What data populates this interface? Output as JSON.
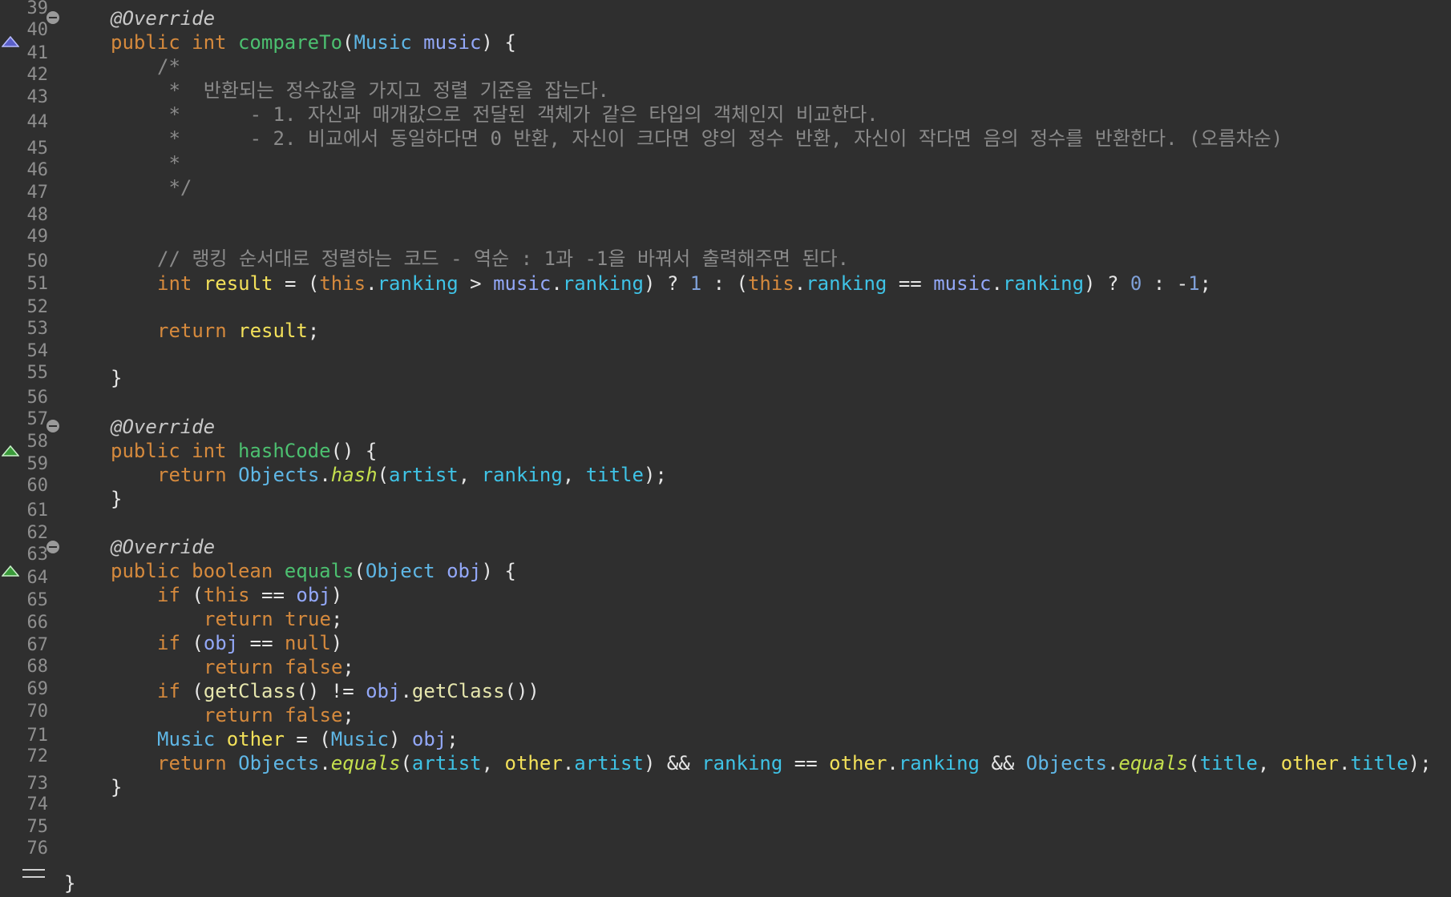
{
  "editor": {
    "line_numbers": [
      "39",
      "40",
      "41",
      "42",
      "43",
      "44",
      "45",
      "46",
      "47",
      "48",
      "49",
      "50",
      "51",
      "52",
      "53",
      "54",
      "55",
      "56",
      "57",
      "58",
      "59",
      "60",
      "61",
      "62",
      "63",
      "64",
      "65",
      "66",
      "67",
      "68",
      "69",
      "70",
      "71",
      "72",
      "73",
      "74",
      "75",
      "76"
    ],
    "fold_markers": [
      "collapse-icon",
      "collapse-icon",
      "collapse-icon"
    ],
    "override_markers": [
      "override-arrow-icon",
      "override-arrow-icon",
      "override-arrow-icon"
    ],
    "colors": {
      "background": "#2f2f2f",
      "keyword": "#d68a3d",
      "method_declaration": "#4cc070",
      "type": "#5fb7e6",
      "parameter": "#93a8f8",
      "local_variable": "#f3e15a",
      "field": "#3fc3e6",
      "number": "#7fa0d8",
      "comment": "#8a8a8a"
    },
    "code_lines": [
      [
        {
          "t": "@Override",
          "c": "ann"
        }
      ],
      [
        {
          "t": "public",
          "c": "kw"
        },
        {
          "t": " ",
          "c": "plain"
        },
        {
          "t": "int",
          "c": "kw"
        },
        {
          "t": " ",
          "c": "plain"
        },
        {
          "t": "compareTo",
          "c": "mdecl"
        },
        {
          "t": "(",
          "c": "plain"
        },
        {
          "t": "Music",
          "c": "type"
        },
        {
          "t": " ",
          "c": "plain"
        },
        {
          "t": "music",
          "c": "param"
        },
        {
          "t": ") {",
          "c": "plain"
        }
      ],
      [
        {
          "t": "/*",
          "c": "comment"
        }
      ],
      [
        {
          "t": " *  반환되는 정수값을 가지고 정렬 기준을 잡는다.",
          "c": "comment"
        }
      ],
      [
        {
          "t": " *      - 1. 자신과 매개값으로 전달된 객체가 같은 타입의 객체인지 비교한다.",
          "c": "comment"
        }
      ],
      [
        {
          "t": " *      - 2. 비교에서 동일하다면 0 반환, 자신이 크다면 양의 정수 반환, 자신이 작다면 음의 정수를 반환한다. (오름차순)",
          "c": "comment"
        }
      ],
      [
        {
          "t": " *",
          "c": "comment"
        }
      ],
      [
        {
          "t": " */",
          "c": "comment"
        }
      ],
      [
        {
          "t": "// 랭킹 순서대로 정렬하는 코드 - 역순 : 1과 -1을 바꿔서 출력해주면 된다.",
          "c": "comment"
        }
      ],
      [
        {
          "t": "int",
          "c": "kw"
        },
        {
          "t": " ",
          "c": "plain"
        },
        {
          "t": "result",
          "c": "local"
        },
        {
          "t": " = (",
          "c": "plain"
        },
        {
          "t": "this",
          "c": "kw"
        },
        {
          "t": ".",
          "c": "plain"
        },
        {
          "t": "ranking",
          "c": "field"
        },
        {
          "t": " > ",
          "c": "plain"
        },
        {
          "t": "music",
          "c": "param"
        },
        {
          "t": ".",
          "c": "plain"
        },
        {
          "t": "ranking",
          "c": "field"
        },
        {
          "t": ") ? ",
          "c": "plain"
        },
        {
          "t": "1",
          "c": "num"
        },
        {
          "t": " : (",
          "c": "plain"
        },
        {
          "t": "this",
          "c": "kw"
        },
        {
          "t": ".",
          "c": "plain"
        },
        {
          "t": "ranking",
          "c": "field"
        },
        {
          "t": " == ",
          "c": "plain"
        },
        {
          "t": "music",
          "c": "param"
        },
        {
          "t": ".",
          "c": "plain"
        },
        {
          "t": "ranking",
          "c": "field"
        },
        {
          "t": ") ? ",
          "c": "plain"
        },
        {
          "t": "0",
          "c": "num"
        },
        {
          "t": " : -",
          "c": "plain"
        },
        {
          "t": "1",
          "c": "num"
        },
        {
          "t": ";",
          "c": "plain"
        }
      ],
      [
        {
          "t": "return",
          "c": "kw"
        },
        {
          "t": " ",
          "c": "plain"
        },
        {
          "t": "result",
          "c": "local"
        },
        {
          "t": ";",
          "c": "plain"
        }
      ],
      [
        {
          "t": "}",
          "c": "plain"
        }
      ],
      [
        {
          "t": "@Override",
          "c": "ann"
        }
      ],
      [
        {
          "t": "public",
          "c": "kw"
        },
        {
          "t": " ",
          "c": "plain"
        },
        {
          "t": "int",
          "c": "kw"
        },
        {
          "t": " ",
          "c": "plain"
        },
        {
          "t": "hashCode",
          "c": "mdecl"
        },
        {
          "t": "() {",
          "c": "plain"
        }
      ],
      [
        {
          "t": "return",
          "c": "kw"
        },
        {
          "t": " ",
          "c": "plain"
        },
        {
          "t": "Objects",
          "c": "type"
        },
        {
          "t": ".",
          "c": "plain"
        },
        {
          "t": "hash",
          "c": "static"
        },
        {
          "t": "(",
          "c": "plain"
        },
        {
          "t": "artist",
          "c": "field"
        },
        {
          "t": ", ",
          "c": "plain"
        },
        {
          "t": "ranking",
          "c": "field"
        },
        {
          "t": ", ",
          "c": "plain"
        },
        {
          "t": "title",
          "c": "field"
        },
        {
          "t": ");",
          "c": "plain"
        }
      ],
      [
        {
          "t": "}",
          "c": "plain"
        }
      ],
      [
        {
          "t": "@Override",
          "c": "ann"
        }
      ],
      [
        {
          "t": "public",
          "c": "kw"
        },
        {
          "t": " ",
          "c": "plain"
        },
        {
          "t": "boolean",
          "c": "kw"
        },
        {
          "t": " ",
          "c": "plain"
        },
        {
          "t": "equals",
          "c": "mdecl"
        },
        {
          "t": "(",
          "c": "plain"
        },
        {
          "t": "Object",
          "c": "type"
        },
        {
          "t": " ",
          "c": "plain"
        },
        {
          "t": "obj",
          "c": "param"
        },
        {
          "t": ") {",
          "c": "plain"
        }
      ],
      [
        {
          "t": "if",
          "c": "kw"
        },
        {
          "t": " (",
          "c": "plain"
        },
        {
          "t": "this",
          "c": "kw"
        },
        {
          "t": " == ",
          "c": "plain"
        },
        {
          "t": "obj",
          "c": "param"
        },
        {
          "t": ")",
          "c": "plain"
        }
      ],
      [
        {
          "t": "return",
          "c": "kw"
        },
        {
          "t": " ",
          "c": "plain"
        },
        {
          "t": "true",
          "c": "kw"
        },
        {
          "t": ";",
          "c": "plain"
        }
      ],
      [
        {
          "t": "if",
          "c": "kw"
        },
        {
          "t": " (",
          "c": "plain"
        },
        {
          "t": "obj",
          "c": "param"
        },
        {
          "t": " == ",
          "c": "plain"
        },
        {
          "t": "null",
          "c": "kw"
        },
        {
          "t": ")",
          "c": "plain"
        }
      ],
      [
        {
          "t": "return",
          "c": "kw"
        },
        {
          "t": " ",
          "c": "plain"
        },
        {
          "t": "false",
          "c": "kw"
        },
        {
          "t": ";",
          "c": "plain"
        }
      ],
      [
        {
          "t": "if",
          "c": "kw"
        },
        {
          "t": " (",
          "c": "plain"
        },
        {
          "t": "getClass",
          "c": "call"
        },
        {
          "t": "() != ",
          "c": "plain"
        },
        {
          "t": "obj",
          "c": "param"
        },
        {
          "t": ".",
          "c": "plain"
        },
        {
          "t": "getClass",
          "c": "call"
        },
        {
          "t": "())",
          "c": "plain"
        }
      ],
      [
        {
          "t": "return",
          "c": "kw"
        },
        {
          "t": " ",
          "c": "plain"
        },
        {
          "t": "false",
          "c": "kw"
        },
        {
          "t": ";",
          "c": "plain"
        }
      ],
      [
        {
          "t": "Music",
          "c": "type"
        },
        {
          "t": " ",
          "c": "plain"
        },
        {
          "t": "other",
          "c": "local"
        },
        {
          "t": " = (",
          "c": "plain"
        },
        {
          "t": "Music",
          "c": "type"
        },
        {
          "t": ") ",
          "c": "plain"
        },
        {
          "t": "obj",
          "c": "param"
        },
        {
          "t": ";",
          "c": "plain"
        }
      ],
      [
        {
          "t": "return",
          "c": "kw"
        },
        {
          "t": " ",
          "c": "plain"
        },
        {
          "t": "Objects",
          "c": "type"
        },
        {
          "t": ".",
          "c": "plain"
        },
        {
          "t": "equals",
          "c": "static"
        },
        {
          "t": "(",
          "c": "plain"
        },
        {
          "t": "artist",
          "c": "field"
        },
        {
          "t": ", ",
          "c": "plain"
        },
        {
          "t": "other",
          "c": "local"
        },
        {
          "t": ".",
          "c": "plain"
        },
        {
          "t": "artist",
          "c": "field"
        },
        {
          "t": ") && ",
          "c": "plain"
        },
        {
          "t": "ranking",
          "c": "field"
        },
        {
          "t": " == ",
          "c": "plain"
        },
        {
          "t": "other",
          "c": "local"
        },
        {
          "t": ".",
          "c": "plain"
        },
        {
          "t": "ranking",
          "c": "field"
        },
        {
          "t": " && ",
          "c": "plain"
        },
        {
          "t": "Objects",
          "c": "type"
        },
        {
          "t": ".",
          "c": "plain"
        },
        {
          "t": "equals",
          "c": "static"
        },
        {
          "t": "(",
          "c": "plain"
        },
        {
          "t": "title",
          "c": "field"
        },
        {
          "t": ", ",
          "c": "plain"
        },
        {
          "t": "other",
          "c": "local"
        },
        {
          "t": ".",
          "c": "plain"
        },
        {
          "t": "title",
          "c": "field"
        },
        {
          "t": ");",
          "c": "plain"
        }
      ],
      [
        {
          "t": "}",
          "c": "plain"
        }
      ],
      [
        {
          "t": "}",
          "c": "plain"
        }
      ]
    ]
  }
}
